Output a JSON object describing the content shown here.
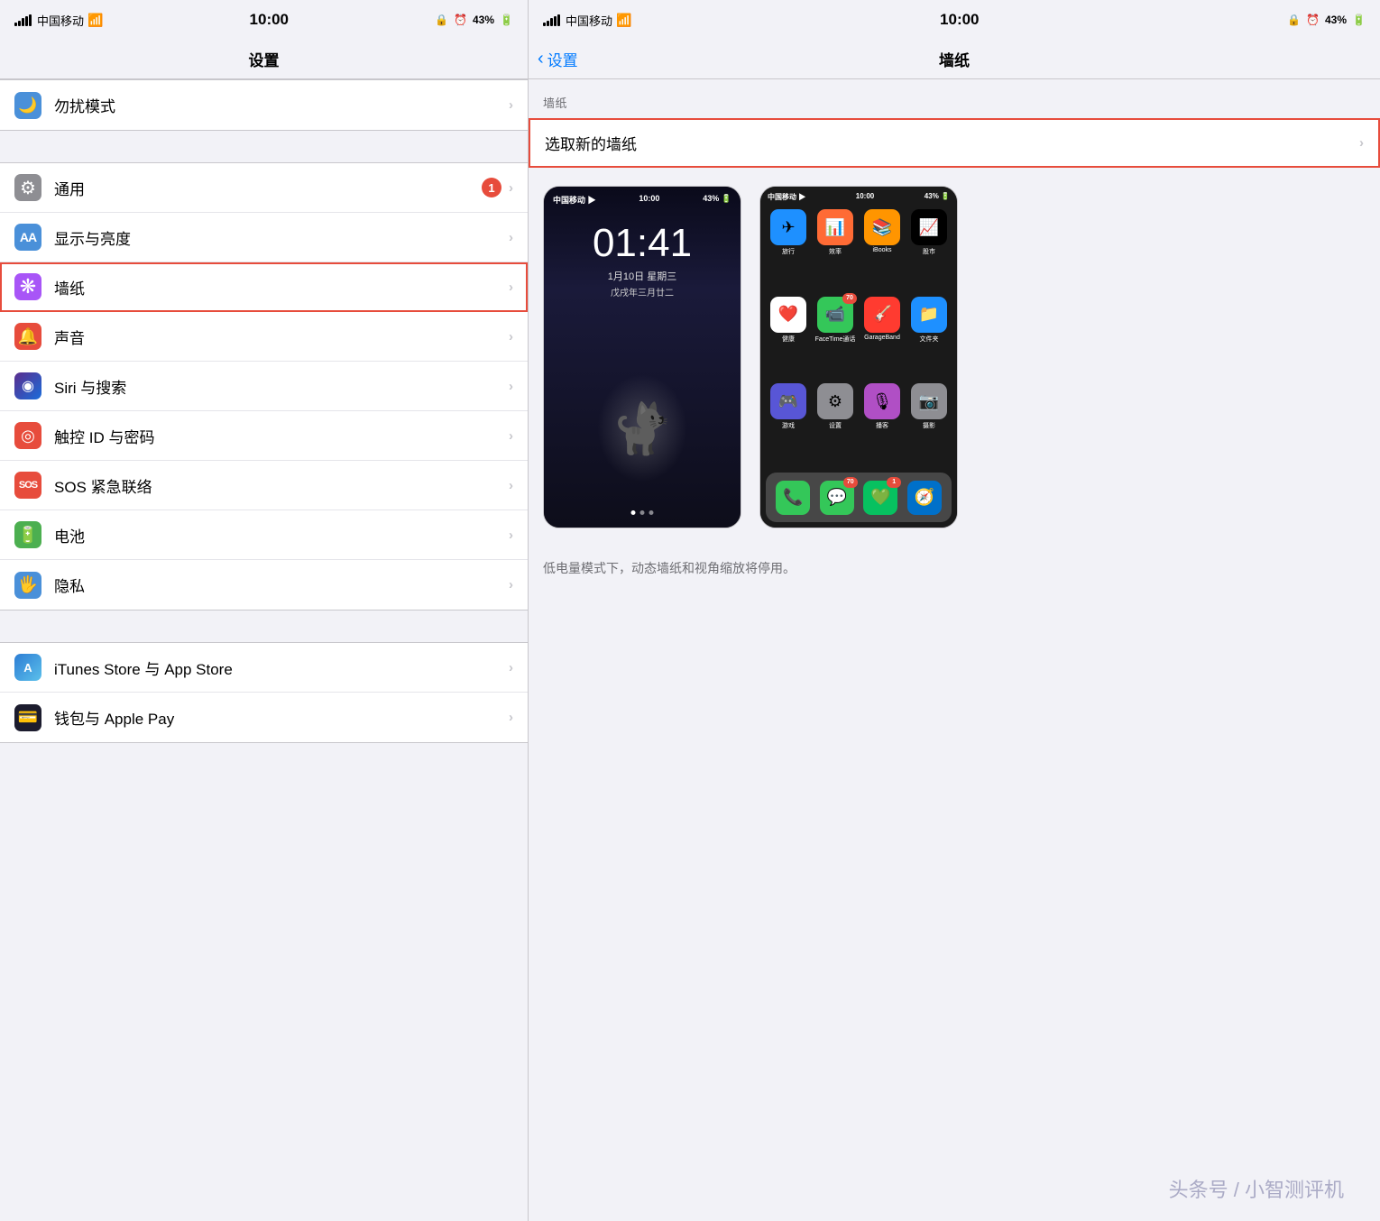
{
  "left": {
    "status": {
      "carrier": "中国移动",
      "time": "10:00",
      "battery": "43%"
    },
    "title": "设置",
    "items": [
      {
        "id": "dnd",
        "label": "勿扰模式",
        "icon": "🌙",
        "bg": "bg-blue",
        "badge": null,
        "highlighted": false
      },
      {
        "id": "general",
        "label": "通用",
        "icon": "⚙️",
        "bg": "bg-gray",
        "badge": "1",
        "highlighted": false
      },
      {
        "id": "display",
        "label": "显示与亮度",
        "icon": "AA",
        "bg": "bg-aa",
        "badge": null,
        "highlighted": false
      },
      {
        "id": "wallpaper",
        "label": "墙纸",
        "icon": "❋",
        "bg": "bg-flower",
        "badge": null,
        "highlighted": true
      },
      {
        "id": "sound",
        "label": "声音",
        "icon": "🔔",
        "bg": "bg-sound",
        "badge": null,
        "highlighted": false
      },
      {
        "id": "siri",
        "label": "Siri 与搜索",
        "icon": "◉",
        "bg": "bg-siri",
        "badge": null,
        "highlighted": false
      },
      {
        "id": "touchid",
        "label": "触控 ID 与密码",
        "icon": "◉",
        "bg": "bg-touch",
        "badge": null,
        "highlighted": false
      },
      {
        "id": "sos",
        "label": "SOS 紧急联络",
        "icon": "SOS",
        "bg": "bg-sos",
        "badge": null,
        "highlighted": false
      },
      {
        "id": "battery",
        "label": "电池",
        "icon": "🔋",
        "bg": "bg-battery",
        "badge": null,
        "highlighted": false
      },
      {
        "id": "privacy",
        "label": "隐私",
        "icon": "✋",
        "bg": "bg-privacy",
        "badge": null,
        "highlighted": false
      }
    ],
    "items2": [
      {
        "id": "itunes",
        "label": "iTunes Store 与 App Store",
        "icon": "A",
        "bg": "bg-itunes",
        "badge": null,
        "highlighted": false
      },
      {
        "id": "wallet",
        "label": "钱包与 Apple Pay",
        "icon": "▣",
        "bg": "bg-wallet",
        "badge": null,
        "highlighted": false
      }
    ]
  },
  "right": {
    "status": {
      "carrier": "中国移动",
      "time": "10:00",
      "battery": "43%"
    },
    "back_label": "设置",
    "title": "墙纸",
    "section_label": "墙纸",
    "select_wallpaper_label": "选取新的墙纸",
    "lock_screen": {
      "time": "01:41",
      "date": "1月10日 星期三",
      "lunar": "戊戌年三月廿二"
    },
    "notice": "低电量模式下，动态墙纸和视角缩放将停用。"
  },
  "watermark": "头条号 / 小智测评机"
}
